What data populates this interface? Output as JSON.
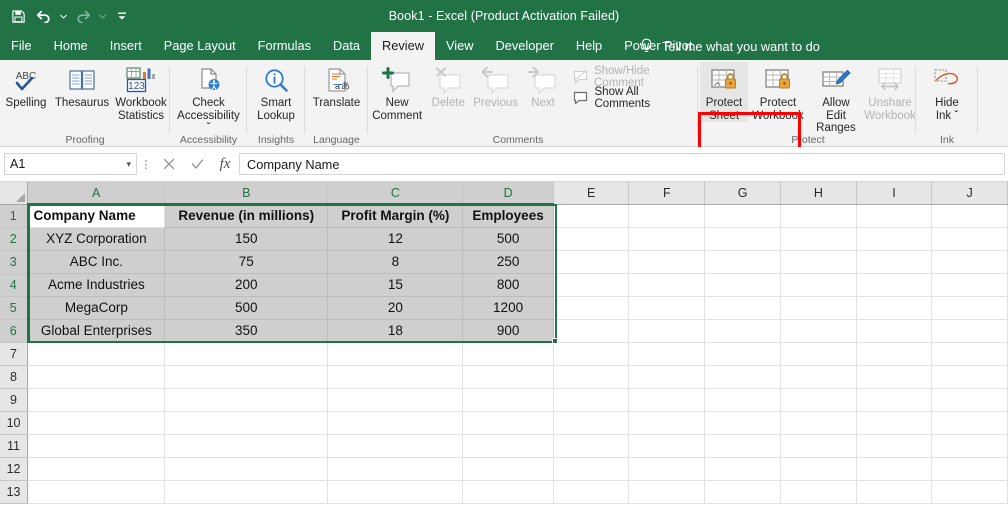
{
  "titlebar": {
    "document_title": "Book1  -  Excel (Product Activation Failed)",
    "quick_access": [
      {
        "name": "save-icon",
        "label": "Save"
      },
      {
        "name": "undo-icon",
        "label": "Undo"
      },
      {
        "name": "redo-icon",
        "label": "Redo"
      },
      {
        "name": "customize-quick-access-toolbar-icon",
        "label": "Customize Quick Access Toolbar"
      }
    ]
  },
  "tabs": [
    {
      "label": "File",
      "active": false
    },
    {
      "label": "Home",
      "active": false
    },
    {
      "label": "Insert",
      "active": false
    },
    {
      "label": "Page Layout",
      "active": false
    },
    {
      "label": "Formulas",
      "active": false
    },
    {
      "label": "Data",
      "active": false
    },
    {
      "label": "Review",
      "active": true
    },
    {
      "label": "View",
      "active": false
    },
    {
      "label": "Developer",
      "active": false
    },
    {
      "label": "Help",
      "active": false
    },
    {
      "label": "Power Pivot",
      "active": false
    }
  ],
  "tell_me": {
    "label": "Tell me what you want to do",
    "icon": "lightbulb-icon"
  },
  "ribbon": {
    "groups": [
      {
        "title": "Proofing",
        "buttons": [
          {
            "label1": "Spelling",
            "label2": "",
            "icon": "spelling-abc-check-icon",
            "disabled": false
          },
          {
            "label1": "Thesaurus",
            "label2": "",
            "icon": "thesaurus-book-icon",
            "disabled": false
          },
          {
            "label1": "Workbook",
            "label2": "Statistics",
            "icon": "workbook-statistics-icon",
            "disabled": false
          }
        ]
      },
      {
        "title": "Accessibility",
        "buttons": [
          {
            "label1": "Check",
            "label2": "Accessibility ˇ",
            "icon": "check-accessibility-icon",
            "disabled": false
          }
        ]
      },
      {
        "title": "Insights",
        "buttons": [
          {
            "label1": "Smart",
            "label2": "Lookup",
            "icon": "smart-lookup-magnifier-icon",
            "disabled": false
          }
        ]
      },
      {
        "title": "Language",
        "buttons": [
          {
            "label1": "Translate",
            "label2": "",
            "icon": "translate-icon",
            "disabled": false
          }
        ]
      },
      {
        "title": "Comments",
        "buttons": [
          {
            "label1": "New",
            "label2": "Comment",
            "icon": "new-comment-icon",
            "disabled": false
          },
          {
            "label1": "Delete",
            "label2": "",
            "icon": "delete-comment-icon",
            "disabled": true
          },
          {
            "label1": "Previous",
            "label2": "",
            "icon": "previous-comment-icon",
            "disabled": true
          },
          {
            "label1": "Next",
            "label2": "",
            "icon": "next-comment-icon",
            "disabled": true
          }
        ],
        "small_buttons": [
          {
            "label": "Show/Hide Comment",
            "icon": "show-hide-comment-icon",
            "disabled": true
          },
          {
            "label": "Show All Comments",
            "icon": "show-all-comments-icon",
            "disabled": false
          }
        ]
      },
      {
        "title": "Protect",
        "buttons": [
          {
            "label1": "Protect",
            "label2": "Sheet",
            "icon": "protect-sheet-lock-icon",
            "disabled": false,
            "highlighted": true
          },
          {
            "label1": "Protect",
            "label2": "Workbook",
            "icon": "protect-workbook-lock-icon",
            "disabled": false,
            "highlighted": true
          },
          {
            "label1": "Allow Edit",
            "label2": "Ranges",
            "icon": "allow-edit-ranges-pencil-icon",
            "disabled": false
          },
          {
            "label1": "Unshare",
            "label2": "Workbook",
            "icon": "unshare-workbook-icon",
            "disabled": true
          }
        ]
      },
      {
        "title": "Ink",
        "buttons": [
          {
            "label1": "Hide",
            "label2": "Ink ˇ",
            "icon": "hide-ink-icon",
            "disabled": false
          }
        ]
      }
    ],
    "highlight_color": "#ff0000"
  },
  "formula_bar": {
    "name_box_value": "A1",
    "cancel_icon": "cancel-x-icon",
    "enter_icon": "enter-check-icon",
    "function_icon": "insert-function-fx-icon",
    "formula_value": "Company Name"
  },
  "grid": {
    "column_headers": [
      "A",
      "B",
      "C",
      "D",
      "E",
      "F",
      "G",
      "H",
      "I",
      "J"
    ],
    "selected_columns": [
      "A",
      "B",
      "C",
      "D"
    ],
    "row_headers": [
      "1",
      "2",
      "3",
      "4",
      "5",
      "6",
      "7",
      "8",
      "9",
      "10",
      "11",
      "12",
      "13"
    ],
    "selected_rows": [
      "1",
      "2",
      "3",
      "4",
      "5",
      "6"
    ],
    "active_cell": "A1",
    "selection_range": "A1:D6",
    "selection_color": "#217346",
    "headers": [
      "Company Name",
      "Revenue (in millions)",
      "Profit Margin (%)",
      "Employees"
    ],
    "rows": [
      [
        "XYZ Corporation",
        "150",
        "12",
        "500"
      ],
      [
        "ABC Inc.",
        "75",
        "8",
        "250"
      ],
      [
        "Acme Industries",
        "200",
        "15",
        "800"
      ],
      [
        "MegaCorp",
        "500",
        "20",
        "1200"
      ],
      [
        "Global Enterprises",
        "350",
        "18",
        "900"
      ]
    ]
  }
}
